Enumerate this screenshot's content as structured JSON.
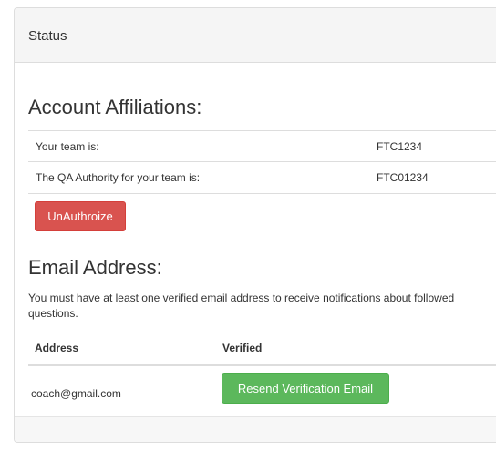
{
  "panel": {
    "title": "Status"
  },
  "affiliations": {
    "heading": "Account Affiliations:",
    "rows": [
      {
        "label": "Your team is:",
        "value": "FTC1234"
      },
      {
        "label": "The QA Authority for your team is:",
        "value": "FTC01234"
      }
    ],
    "unauthorize_label": "UnAuthroize"
  },
  "email": {
    "heading": "Email Address:",
    "description": "You must have at least one verified email address to receive notifications about followed questions.",
    "columns": [
      "Address",
      "Verified"
    ],
    "rows": [
      {
        "address": "coach@gmail.com",
        "action_label": "Resend Verification Email"
      }
    ]
  },
  "colors": {
    "danger": "#d9534f",
    "success": "#5cb85c",
    "panel_heading_bg": "#f5f5f5"
  }
}
